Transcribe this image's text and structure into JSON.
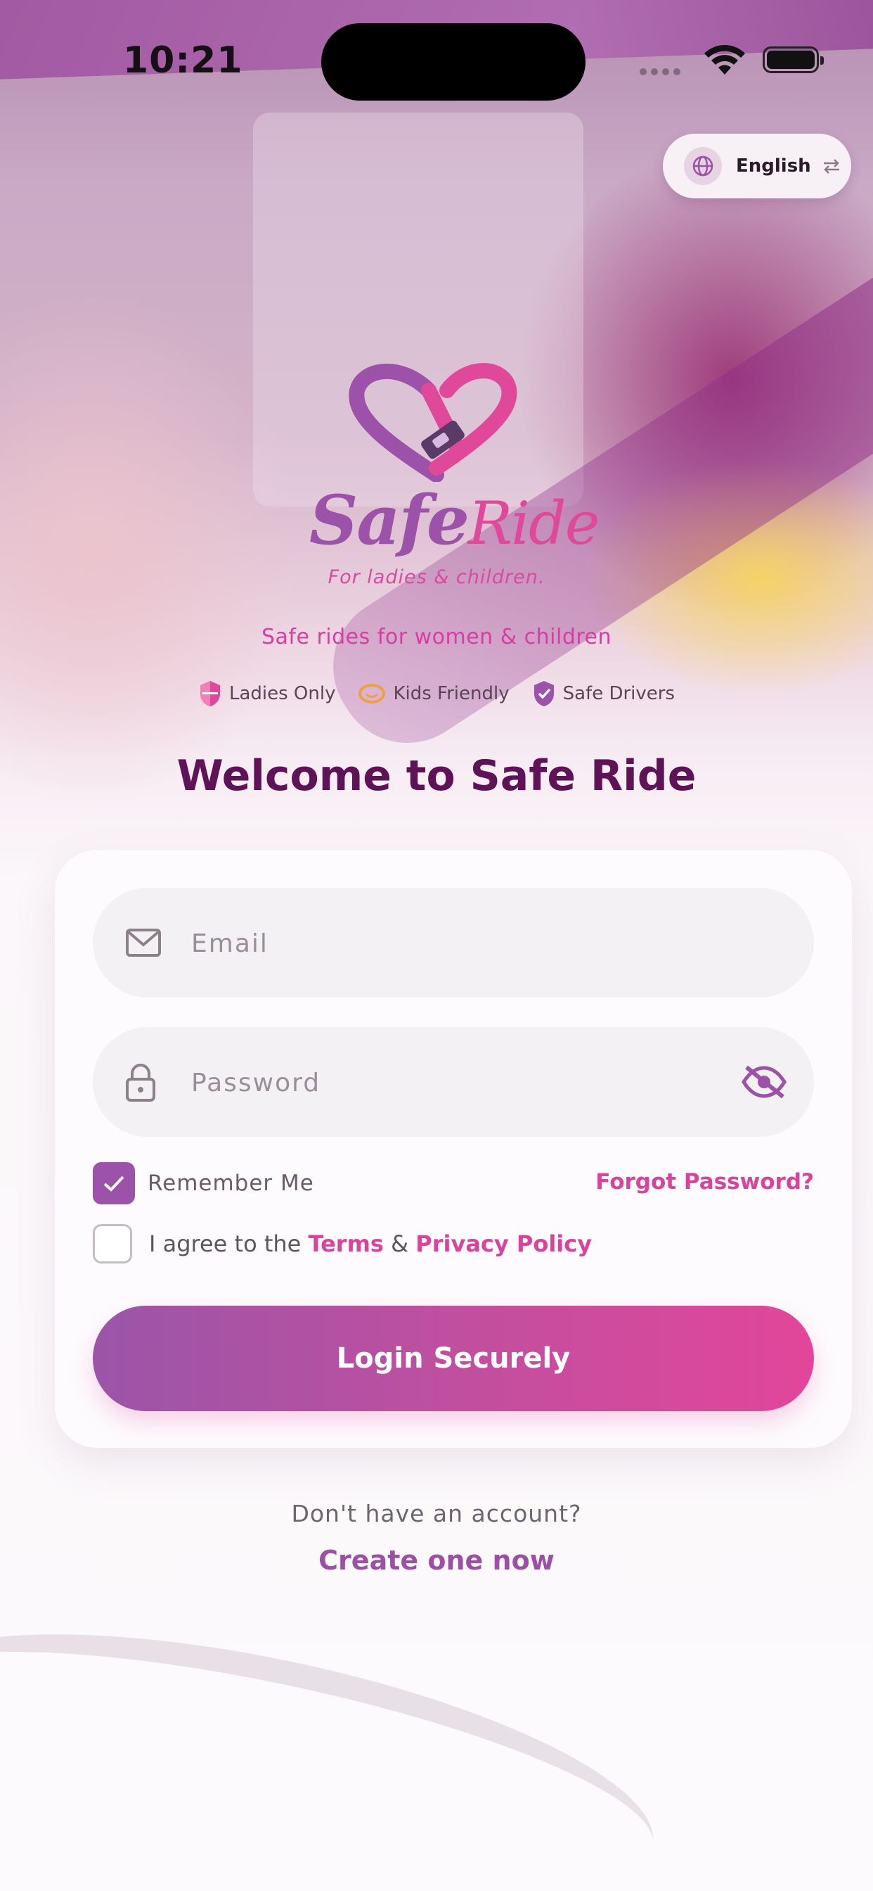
{
  "status_bar": {
    "time": "10:21"
  },
  "language": {
    "label": "English"
  },
  "logo": {
    "word1": "Safe",
    "word2": "Ride",
    "subtitle": "For ladies & children."
  },
  "tagline": "Safe rides for women & children",
  "badges": [
    {
      "label": "Ladies Only",
      "icon": "shield-icon",
      "color": "#e0489a"
    },
    {
      "label": "Kids Friendly",
      "icon": "smile-icon",
      "color": "#f0a040"
    },
    {
      "label": "Safe Drivers",
      "icon": "shield-check-icon",
      "color": "#9b52a8"
    }
  ],
  "welcome_title": "Welcome to Safe Ride",
  "form": {
    "email_placeholder": "Email",
    "password_placeholder": "Password",
    "remember_label": "Remember Me",
    "remember_checked": true,
    "forgot_label": "Forgot Password?",
    "agree_prefix": "I agree to the",
    "terms_label": "Terms",
    "amp": "&",
    "privacy_label": "Privacy Policy",
    "agree_checked": false,
    "login_label": "Login Securely"
  },
  "footer": {
    "prompt": "Don't have an account?",
    "create_label": "Create one now"
  },
  "colors": {
    "primary": "#9b52a8",
    "accent": "#e0489a",
    "title": "#5e1357"
  }
}
